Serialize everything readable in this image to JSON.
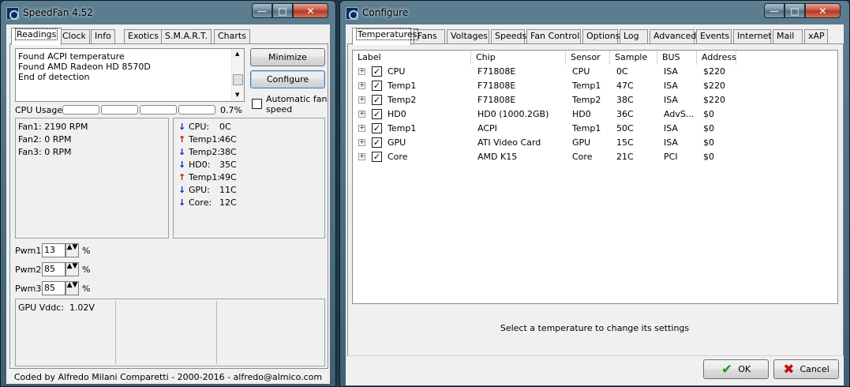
{
  "speedfan": {
    "title": "SpeedFan 4.52",
    "tabs": [
      "Readings",
      "Clock",
      "Info",
      "Exotics",
      "S.M.A.R.T.",
      "Charts"
    ],
    "log_lines": [
      "Found ACPI temperature",
      "Found AMD Radeon HD 8570D",
      "End of detection"
    ],
    "minimize_label": "Minimize",
    "configure_label": "Configure",
    "auto_fan_label": "Automatic fan speed",
    "cpu_usage_label": "CPU Usage",
    "cpu_usage_value": "0.7%",
    "fans": [
      "Fan1: 2190 RPM",
      "Fan2: 0 RPM",
      "Fan3: 0 RPM"
    ],
    "temps": [
      {
        "name": "CPU:",
        "value": "0C",
        "trend": "down"
      },
      {
        "name": "Temp1:",
        "value": "46C",
        "trend": "up"
      },
      {
        "name": "Temp2:",
        "value": "38C",
        "trend": "down"
      },
      {
        "name": "HD0:",
        "value": "35C",
        "trend": "down"
      },
      {
        "name": "Temp1:",
        "value": "49C",
        "trend": "up"
      },
      {
        "name": "GPU:",
        "value": "11C",
        "trend": "down"
      },
      {
        "name": "Core:",
        "value": "12C",
        "trend": "down"
      }
    ],
    "pwm": [
      {
        "label": "Pwm1:",
        "value": "13",
        "unit": "%"
      },
      {
        "label": "Pwm2:",
        "value": "85",
        "unit": "%"
      },
      {
        "label": "Pwm3:",
        "value": "85",
        "unit": "%"
      }
    ],
    "gpu_vddc": "GPU Vddc:  1.02V",
    "footer": "Coded by Alfredo Milani Comparetti - 2000-2016 - alfredo@almico.com"
  },
  "configure": {
    "title": "Configure",
    "tabs": [
      "Temperatures",
      "Fans",
      "Voltages",
      "Speeds",
      "Fan Control",
      "Options",
      "Log",
      "Advanced",
      "Events",
      "Internet",
      "Mail",
      "xAP"
    ],
    "columns": [
      "Label",
      "Chip",
      "Sensor",
      "Sample",
      "BUS",
      "Address"
    ],
    "rows": [
      {
        "label": "CPU",
        "chip": "F71808E",
        "sensor": "CPU",
        "sample": "0C",
        "bus": "ISA",
        "address": "$220"
      },
      {
        "label": "Temp1",
        "chip": "F71808E",
        "sensor": "Temp1",
        "sample": "47C",
        "bus": "ISA",
        "address": "$220"
      },
      {
        "label": "Temp2",
        "chip": "F71808E",
        "sensor": "Temp2",
        "sample": "38C",
        "bus": "ISA",
        "address": "$220"
      },
      {
        "label": "HD0",
        "chip": "HD0 (1000.2GB)",
        "sensor": "HD0",
        "sample": "36C",
        "bus": "AdvS...",
        "address": "$0"
      },
      {
        "label": "Temp1",
        "chip": "ACPI",
        "sensor": "Temp1",
        "sample": "50C",
        "bus": "ISA",
        "address": "$0"
      },
      {
        "label": "GPU",
        "chip": "ATI Video Card",
        "sensor": "GPU",
        "sample": "15C",
        "bus": "ISA",
        "address": "$0"
      },
      {
        "label": "Core",
        "chip": "AMD K15",
        "sensor": "Core",
        "sample": "21C",
        "bus": "PCI",
        "address": "$0"
      }
    ],
    "hint": "Select a temperature to change its settings",
    "ok_label": "OK",
    "cancel_label": "Cancel"
  },
  "colors": {
    "up_arrow": "#e00000",
    "down_arrow": "#0020d0",
    "ok_check": "#1a9a1a",
    "cancel_x": "#c01010"
  }
}
